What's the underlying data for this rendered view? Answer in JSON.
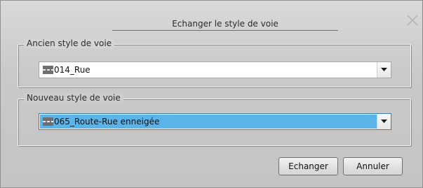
{
  "dialog": {
    "title": "Echanger le style de voie"
  },
  "old_style": {
    "legend": "Ancien style de voie",
    "value": "014_Rue",
    "icon": "road-style-swatch-icon"
  },
  "new_style": {
    "legend": "Nouveau style de voie",
    "value": "065_Route-Rue enneigée",
    "icon": "road-style-swatch-icon",
    "highlight_color": "#5ab4e8"
  },
  "buttons": {
    "confirm": "Echanger",
    "cancel": "Annuler"
  }
}
